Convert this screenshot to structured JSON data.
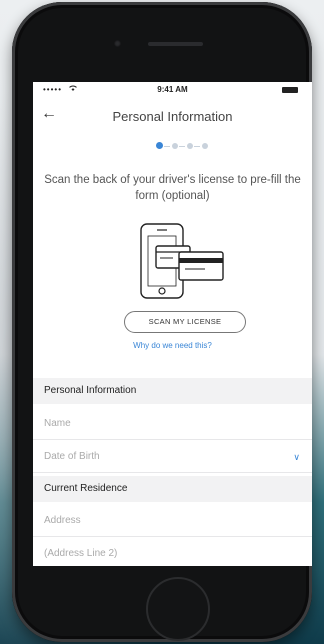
{
  "status_bar": {
    "carrier": "•••••",
    "time": "9:41 AM"
  },
  "nav": {
    "title": "Personal Information"
  },
  "steps": {
    "current": 1,
    "total": 4
  },
  "scan": {
    "description": "Scan the back of your driver's license to pre-fill the form (optional)",
    "button_label": "SCAN MY LICENSE",
    "why_link": "Why do we need this?"
  },
  "personal_section": {
    "heading": "Personal Information",
    "name_placeholder": "Name",
    "dob_placeholder": "Date of Birth"
  },
  "residence_section": {
    "heading": "Current Residence",
    "address_placeholder": "Address",
    "address2_placeholder": "(Address Line 2)"
  },
  "colors": {
    "accent": "#3a86d6",
    "section_bg": "#f2f2f3"
  },
  "icons": [
    "back-arrow-icon",
    "wifi-icon",
    "battery-icon",
    "chevron-down-icon",
    "phone-card-illustration-icon"
  ]
}
